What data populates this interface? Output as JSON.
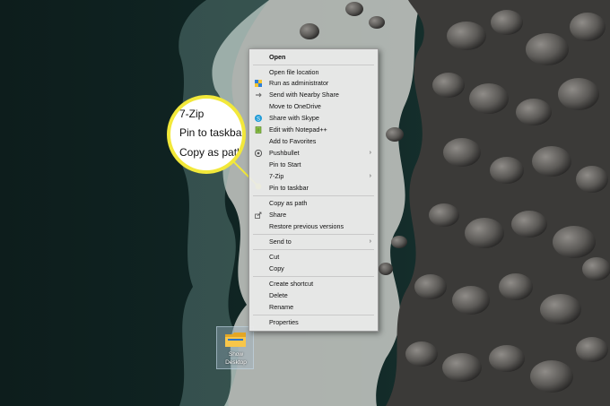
{
  "menu": {
    "items": [
      {
        "label": "Open",
        "bold": true,
        "icon": "",
        "arrow": false
      },
      {
        "label": "Open file location",
        "icon": "",
        "arrow": false
      },
      {
        "label": "Run as administrator",
        "icon": "uac-shield-icon",
        "arrow": false
      },
      {
        "label": "Send with Nearby Share",
        "icon": "nearby-share-icon",
        "arrow": false
      },
      {
        "label": "Move to OneDrive",
        "icon": "",
        "arrow": false
      },
      {
        "label": "Share with Skype",
        "icon": "skype-icon",
        "arrow": false
      },
      {
        "label": "Edit with Notepad++",
        "icon": "notepad-plus-plus-icon",
        "arrow": false
      },
      {
        "label": "Add to Favorites",
        "icon": "",
        "arrow": false
      },
      {
        "label": "Pushbullet",
        "icon": "pushbullet-icon",
        "arrow": true
      },
      {
        "label": "Pin to Start",
        "icon": "",
        "arrow": false
      },
      {
        "label": "7-Zip",
        "icon": "",
        "arrow": true
      },
      {
        "label": "Pin to taskbar",
        "icon": "",
        "arrow": false
      },
      {
        "label": "Copy as path",
        "icon": "",
        "arrow": false
      },
      {
        "label": "Share",
        "icon": "share-icon",
        "arrow": false
      },
      {
        "label": "Restore previous versions",
        "icon": "",
        "arrow": false
      },
      {
        "label": "Send to",
        "icon": "",
        "arrow": true
      },
      {
        "label": "Cut",
        "icon": "",
        "arrow": false
      },
      {
        "label": "Copy",
        "icon": "",
        "arrow": false
      },
      {
        "label": "Create shortcut",
        "icon": "",
        "arrow": false
      },
      {
        "label": "Delete",
        "icon": "",
        "arrow": false
      },
      {
        "label": "Rename",
        "icon": "",
        "arrow": false
      },
      {
        "label": "Properties",
        "icon": "",
        "arrow": false
      }
    ],
    "arrow_glyph": "›"
  },
  "callout": {
    "lines": [
      "7-Zip",
      "Pin to taskbar",
      "Copy as path"
    ],
    "ring_color": "#f2e83a"
  },
  "desktop_icon": {
    "label_line1": "Show",
    "label_line2": "Desktop"
  }
}
